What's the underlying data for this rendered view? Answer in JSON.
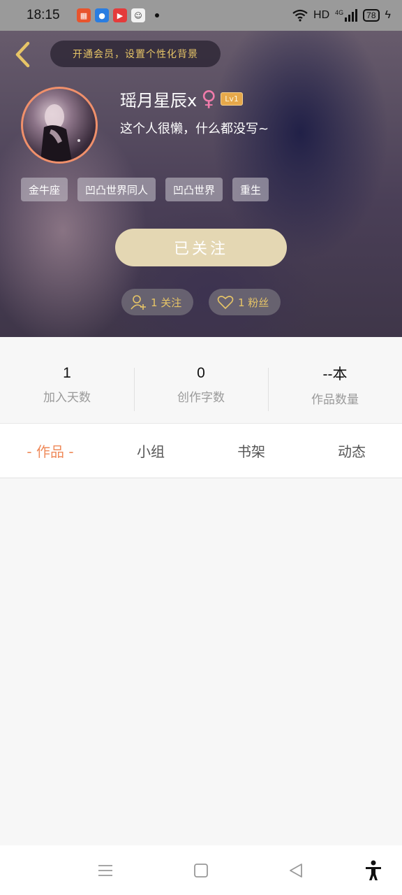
{
  "status_bar": {
    "time": "18:15",
    "network": "HD",
    "signal": "4G",
    "battery": "78"
  },
  "header": {
    "vip_banner": "开通会员，设置个性化背景"
  },
  "profile": {
    "username": "瑶月星辰x",
    "gender_symbol": "♀",
    "level": "Lv1",
    "bio": "这个人很懒，什么都没写~",
    "tags": [
      "金牛座",
      "凹凸世界同人",
      "凹凸世界",
      "重生"
    ],
    "follow_button": "已关注",
    "following_count": "1 关注",
    "followers_count": "1 粉丝"
  },
  "stats": [
    {
      "value": "1",
      "label": "加入天数"
    },
    {
      "value": "0",
      "label": "创作字数"
    },
    {
      "value": "--本",
      "label": "作品数量"
    }
  ],
  "tabs": [
    {
      "label": "- 作品 -",
      "active": true
    },
    {
      "label": "小组",
      "active": false
    },
    {
      "label": "书架",
      "active": false
    },
    {
      "label": "动态",
      "active": false
    }
  ],
  "colors": {
    "accent": "#ef8a5a",
    "gold": "#e7c567",
    "follow_button": "#e4d7b3"
  }
}
